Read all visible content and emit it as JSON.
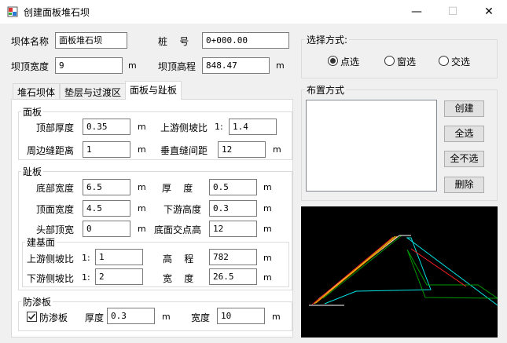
{
  "window": {
    "title": "创建面板堆石坝",
    "minimize": "—",
    "maximize": "☐",
    "close": "✕"
  },
  "top": {
    "dam_name_label": "坝体名称",
    "dam_name_value": "面板堆石坝",
    "station_label": "桩    号",
    "station_value": "0+000.00",
    "crest_width_label": "坝顶宽度",
    "crest_width_value": "9",
    "crest_width_unit": "m",
    "crest_elev_label": "坝顶高程",
    "crest_elev_value": "848.47",
    "crest_elev_unit": "m"
  },
  "tabs": [
    "堆石坝体",
    "垫层与过渡区",
    "面板与趾板"
  ],
  "panel": {
    "face_slab": {
      "title": "面板",
      "top_thickness_label": "顶部厚度",
      "top_thickness_value": "0.35",
      "top_thickness_unit": "m",
      "upstream_slope_label": "上游侧坡比",
      "upstream_slope_prefix": "1:",
      "upstream_slope_value": "1.4",
      "perimeter_joint_label": "周边缝距离",
      "perimeter_joint_value": "1",
      "perimeter_joint_unit": "m",
      "vertical_joint_label": "垂直缝间距",
      "vertical_joint_value": "12",
      "vertical_joint_unit": "m"
    },
    "toe_slab": {
      "title": "趾板",
      "bottom_width_label": "底部宽度",
      "bottom_width_value": "6.5",
      "bottom_width_unit": "m",
      "thickness_label": "厚    度",
      "thickness_value": "0.5",
      "thickness_unit": "m",
      "top_width_label": "顶面宽度",
      "top_width_value": "4.5",
      "top_width_unit": "m",
      "downstream_height_label": "下游高度",
      "downstream_height_value": "0.3",
      "downstream_height_unit": "m",
      "head_top_width_label": "头部顶宽",
      "head_top_width_value": "0",
      "head_top_width_unit": "m",
      "bottom_intersection_label": "底面交点高",
      "bottom_intersection_value": "12",
      "bottom_intersection_unit": "m"
    },
    "foundation": {
      "title": "建基面",
      "upstream_slope_label": "上游侧坡比",
      "upstream_slope_prefix": "1:",
      "upstream_slope_value": "1",
      "elevation_label": "高    程",
      "elevation_value": "782",
      "elevation_unit": "m",
      "downstream_slope_label": "下游侧坡比",
      "downstream_slope_prefix": "1:",
      "downstream_slope_value": "2",
      "width_label": "宽    度",
      "width_value": "26.5",
      "width_unit": "m"
    },
    "seepage_plate": {
      "title": "防渗板",
      "checkbox_label": "防渗板",
      "checked": true,
      "thickness_label": "厚度",
      "thickness_value": "0.3",
      "thickness_unit": "m",
      "width_label": "宽度",
      "width_value": "10",
      "width_unit": "m"
    }
  },
  "selection": {
    "title": "选择方式:",
    "options": [
      "点选",
      "窗选",
      "交选"
    ],
    "selected_index": 0
  },
  "layout_mode": {
    "title": "布置方式",
    "buttons": [
      "创建",
      "全选",
      "全不选",
      "删除"
    ]
  },
  "colors": {
    "preview_bg": "#000000",
    "white_line": "#ffffff",
    "cyan_line": "#00e5e5",
    "green_line": "#009900",
    "red_line": "#ff2020",
    "yellow_line": "#e0e000",
    "orange_line": "#ff8000"
  }
}
